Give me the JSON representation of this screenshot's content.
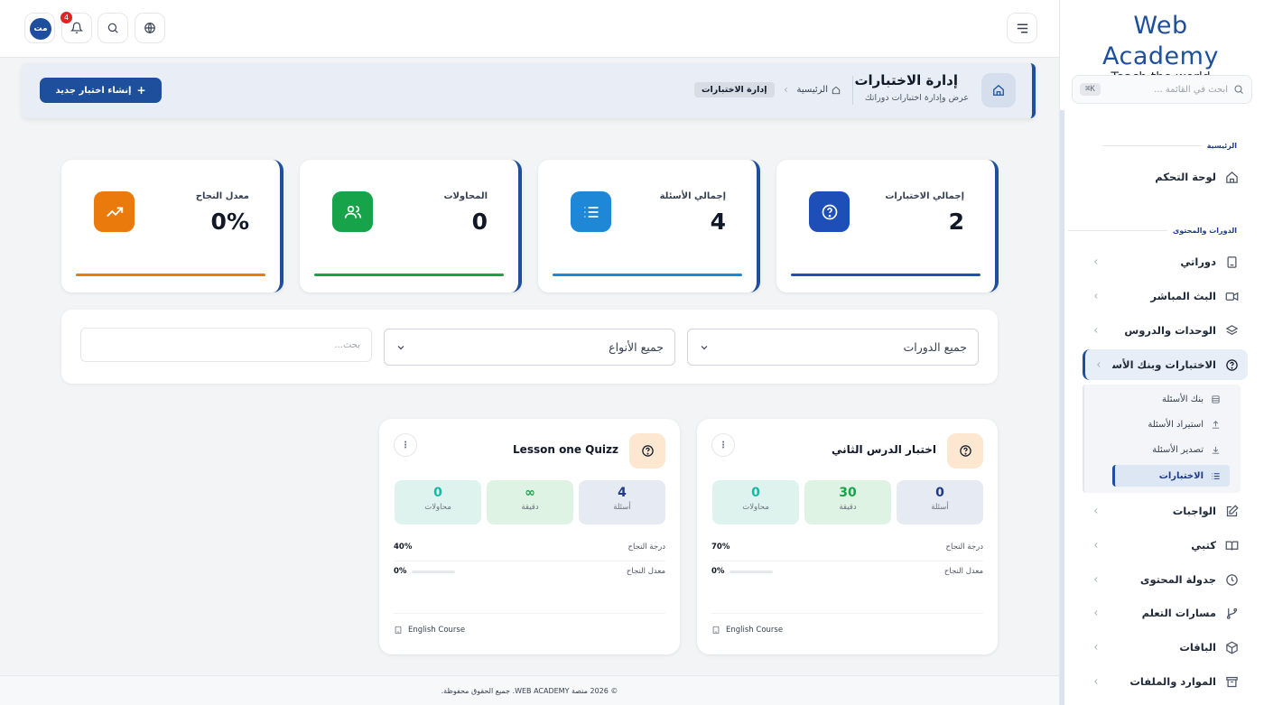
{
  "brand": {
    "name": "Web Academy",
    "tagline": "Teach the world"
  },
  "sidebar": {
    "search_placeholder": "ابحث في القائمة ...",
    "shortcut": "⌘K",
    "sections": [
      {
        "label": "الرئيسية"
      },
      {
        "label": "الدورات والمحتوى"
      }
    ],
    "items": [
      {
        "label": "لوحة التحكم",
        "icon": "home-icon"
      },
      {
        "label": "دوراتي",
        "icon": "book-icon"
      },
      {
        "label": "البث المباشر",
        "icon": "video-icon"
      },
      {
        "label": "الوحدات والدروس",
        "icon": "layers-icon"
      },
      {
        "label": "الاختبارات وبنك الأسئلة",
        "icon": "help-circle-icon"
      },
      {
        "label": "الواجبات",
        "icon": "edit-icon"
      },
      {
        "label": "كتبي",
        "icon": "book-open-icon"
      },
      {
        "label": "جدولة المحتوى",
        "icon": "clock-icon"
      },
      {
        "label": "مسارات التعلم",
        "icon": "git-branch-icon"
      },
      {
        "label": "الباقات",
        "icon": "package-icon"
      },
      {
        "label": "الموارد والملفات",
        "icon": "archive-icon"
      }
    ],
    "subitems": [
      {
        "label": "بنك الأسئلة"
      },
      {
        "label": "استيراد الأسئلة"
      },
      {
        "label": "تصدير الأسئلة"
      },
      {
        "label": "الاختبارات"
      }
    ]
  },
  "topbar": {
    "avatar_initials": "مت",
    "notification_count": "4"
  },
  "header": {
    "title": "إدارة الاختبارات",
    "subtitle": "عرض وإدارة اختبارات دوراتك",
    "breadcrumb_home": "الرئيسية",
    "breadcrumb_current": "إدارة الاختبارات",
    "new_button": "إنشاء اختبار جديد"
  },
  "stats": [
    {
      "label": "إجمالي الاختبارات",
      "value": "2",
      "color": "#1e4fb8"
    },
    {
      "label": "إجمالي الأسئلة",
      "value": "4",
      "color": "#1e88d6"
    },
    {
      "label": "المحاولات",
      "value": "0",
      "color": "#16a34a"
    },
    {
      "label": "معدل النجاح",
      "value": "0%",
      "color": "#ea7a0c"
    }
  ],
  "filters": {
    "courses": "جميع الدورات",
    "types": "جميع الأنواع",
    "search_placeholder": "بحث..."
  },
  "quizzes": [
    {
      "title": "اختبار الدرس الثاني",
      "questions": "0",
      "questions_label": "أسئلة",
      "minutes": "30",
      "minutes_label": "دقيقة",
      "attempts": "0",
      "attempts_label": "محاولات",
      "pass_grade_label": "درجة النجاح",
      "pass_grade": "70%",
      "pass_rate_label": "معدل النجاح",
      "pass_rate": "0%",
      "course": "English Course"
    },
    {
      "title": "Lesson one Quizz",
      "questions": "4",
      "questions_label": "أسئلة",
      "minutes": "∞",
      "minutes_label": "دقيقة",
      "attempts": "0",
      "attempts_label": "محاولات",
      "pass_grade_label": "درجة النجاح",
      "pass_grade": "40%",
      "pass_rate_label": "معدل النجاح",
      "pass_rate": "0%",
      "course": "English Course"
    }
  ],
  "footer": "© 2026 منصة WEB ACADEMY. جميع الحقوق محفوظة."
}
